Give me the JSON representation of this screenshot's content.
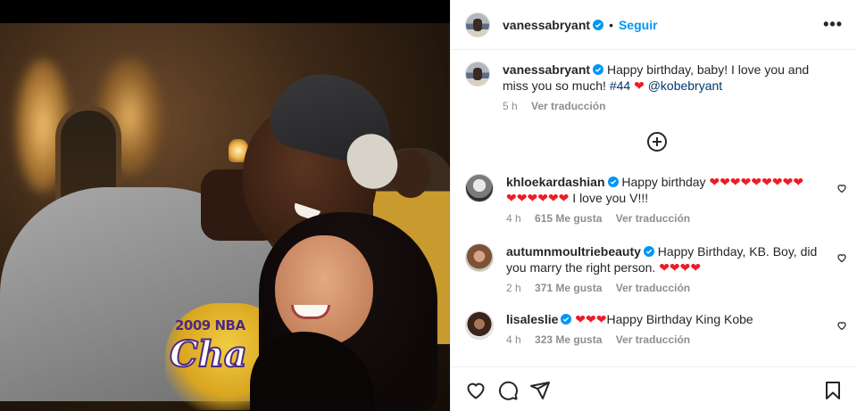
{
  "post": {
    "author": "vanessabryant",
    "follow_label": "Seguir",
    "separator": "•",
    "more_label": "•••",
    "caption": {
      "username": "vanessabryant",
      "text_before": "Happy birthday, baby! I love you and miss you so much!",
      "hashtag": "#44",
      "heart": "❤",
      "mention": "@kobebryant",
      "time": "5 h",
      "translate_label": "Ver traducción"
    },
    "photo": {
      "shirt_text": "2009 NBA",
      "shirt_script": "Cha"
    }
  },
  "comments": [
    {
      "username": "khloekardashian",
      "line1": "Happy birthday ❤❤❤❤❤❤❤❤❤",
      "line2": "❤❤❤❤❤❤ I love you V!!!",
      "time": "4 h",
      "likes": "615 Me gusta",
      "translate_label": "Ver traducción"
    },
    {
      "username": "autumnmoultriebeauty",
      "text": "Happy Birthday, KB. Boy, did you marry the right person. ❤❤❤❤",
      "time": "2 h",
      "likes": "371 Me gusta",
      "translate_label": "Ver traducción"
    },
    {
      "username": "lisaleslie",
      "text": "❤❤❤Happy Birthday King Kobe",
      "time": "4 h",
      "likes": "323 Me gusta",
      "translate_label": "Ver traducción"
    }
  ],
  "actions": {
    "icons": [
      "heart-icon",
      "comment-icon",
      "share-icon",
      "bookmark-icon"
    ]
  },
  "colors": {
    "accent": "#0095f6",
    "link": "#00376b",
    "heart": "#ed1c24",
    "muted": "#8e8e8e",
    "text": "#262626"
  }
}
